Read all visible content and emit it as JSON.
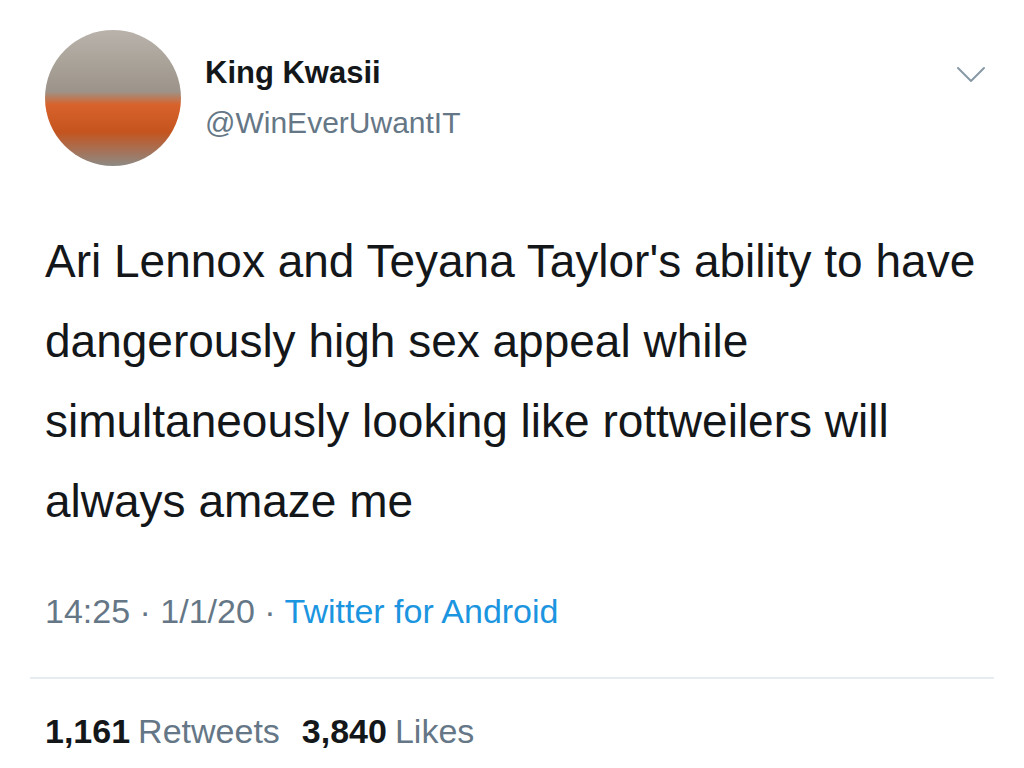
{
  "account": {
    "name": "King Kwasii",
    "handle": "@WinEverUwantIT"
  },
  "tweet": {
    "text": "Ari Lennox and Teyana Taylor's ability to have dangerously high sex appeal while simultaneously looking like rottweilers will always amaze me"
  },
  "meta": {
    "time": "14:25",
    "separator": "·",
    "date": "1/1/20",
    "source": "Twitter for Android"
  },
  "stats": [
    {
      "count": "1,161",
      "label": "Retweets"
    },
    {
      "count": "3,840",
      "label": "Likes"
    }
  ]
}
